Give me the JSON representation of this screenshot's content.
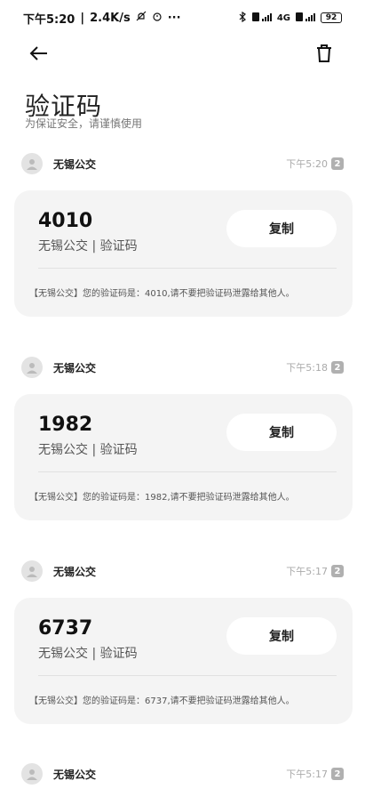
{
  "statusbar": {
    "time": "下午5:20",
    "speed": "2.4K/s",
    "right": "4G",
    "battery": "92"
  },
  "header": {
    "title": "验证码",
    "subtitle": "为保证安全，请谨慎使用"
  },
  "copy_label": "复制",
  "threads": [
    {
      "sender": "无锡公交",
      "time": "下午5:20",
      "sim": "2",
      "code": "4010",
      "label": "无锡公交 | 验证码",
      "message": "【无锡公交】您的验证码是：4010,请不要把验证码泄露给其他人。"
    },
    {
      "sender": "无锡公交",
      "time": "下午5:18",
      "sim": "2",
      "code": "1982",
      "label": "无锡公交 | 验证码",
      "message": "【无锡公交】您的验证码是：1982,请不要把验证码泄露给其他人。"
    },
    {
      "sender": "无锡公交",
      "time": "下午5:17",
      "sim": "2",
      "code": "6737",
      "label": "无锡公交 | 验证码",
      "message": "【无锡公交】您的验证码是：6737,请不要把验证码泄露给其他人。"
    },
    {
      "sender": "无锡公交",
      "time": "下午5:17",
      "sim": "2"
    }
  ],
  "icons": {
    "back": "back-arrow-icon",
    "delete": "trash-icon"
  }
}
